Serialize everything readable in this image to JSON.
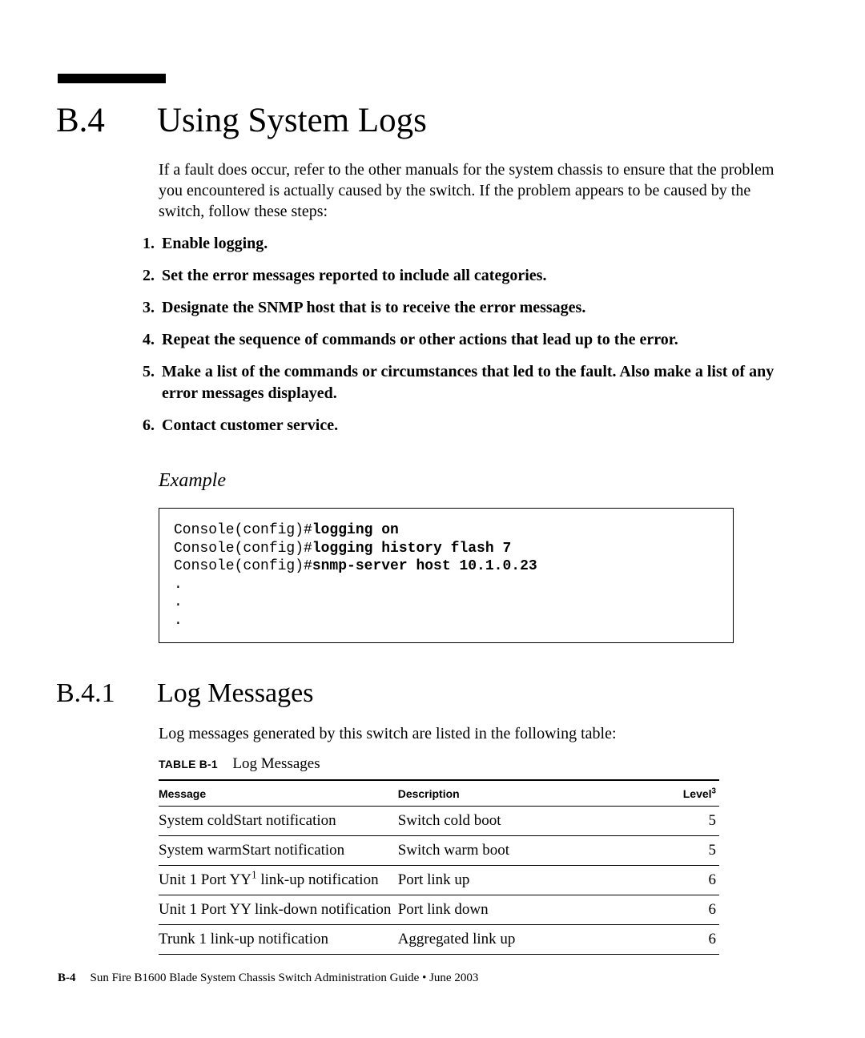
{
  "section": {
    "number": "B.4",
    "title": "Using System Logs"
  },
  "intro": "If a fault does occur, refer to the other manuals for the system chassis to ensure that the problem you encountered is actually caused by the switch. If the problem appears to be caused by the switch, follow these steps:",
  "steps": [
    "Enable logging.",
    "Set the error messages reported to include all categories.",
    "Designate the SNMP host that is to receive the error messages.",
    "Repeat the sequence of commands or other actions that lead up to the error.",
    "Make a list of the commands or circumstances that led to the fault. Also make a list of any error messages displayed.",
    "Contact customer service."
  ],
  "example": {
    "heading": "Example",
    "lines": [
      {
        "prompt": "Console(config)#",
        "cmd": "logging on"
      },
      {
        "prompt": "Console(config)#",
        "cmd": "logging history flash 7"
      },
      {
        "prompt": "Console(config)#",
        "cmd": "snmp-server host 10.1.0.23"
      }
    ],
    "ellipses": [
      ".",
      ".",
      "."
    ]
  },
  "subsection": {
    "number": "B.4.1",
    "title": "Log Messages"
  },
  "subsection_intro": "Log messages generated by this switch are listed in the following table:",
  "table": {
    "caption_label": "TABLE B-1",
    "caption_text": "Log Messages",
    "columns": [
      "Message",
      "Description",
      "Level"
    ],
    "level_note": "3",
    "rows": [
      {
        "message": "System coldStart notification",
        "sup": "",
        "description": "Switch cold boot",
        "level": "5"
      },
      {
        "message": "System warmStart notification",
        "sup": "",
        "description": "Switch warm boot",
        "level": "5"
      },
      {
        "message": "Unit 1 Port YY",
        "sup": "1",
        "message_tail": " link-up notification",
        "description": "Port link up",
        "level": "6"
      },
      {
        "message": "Unit 1 Port YY link-down notification",
        "sup": "",
        "description": "Port link down",
        "level": "6"
      },
      {
        "message": "Trunk 1 link-up notification",
        "sup": "",
        "description": "Aggregated link up",
        "level": "6"
      }
    ]
  },
  "footer": {
    "page": "B-4",
    "text": "Sun Fire B1600 Blade System Chassis Switch Administration Guide  •  June 2003"
  }
}
